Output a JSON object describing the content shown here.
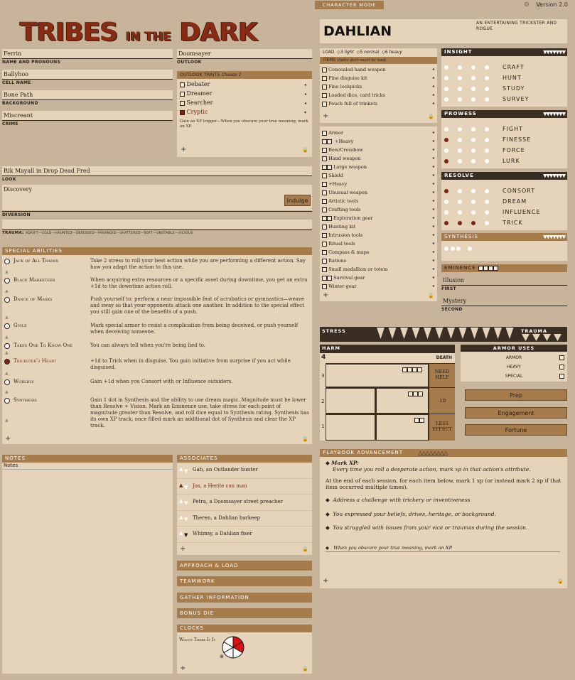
{
  "topbar": {
    "mode": "CHARACTER MODE",
    "version": "Version 2.0"
  },
  "logo": {
    "part1": "TRIBES",
    "part2": "IN THE",
    "part3": "DARK"
  },
  "identity": {
    "name_value": "Ferrin",
    "name_label": "NAME AND PRONOUNS",
    "cell_value": "Ballyhoo",
    "cell_label": "CELL NAME",
    "background_value": "Bone Path",
    "background_label": "BACKGROUND",
    "crime_value": "Miscreant",
    "crime_label": "CRIME",
    "outlook_value": "Doomsayer",
    "outlook_label": "OUTLOOK",
    "look_value": "Rik Mayall in Drop Dead Fred",
    "look_label": "LOOK",
    "diversion_value": "Discovery",
    "diversion_label": "DIVERSION",
    "indulge": "Indulge",
    "trauma_label": "TRAUMA:",
    "trauma_list": "ADRIFT—COLD—HAUNTED—OBSESSED—PARANOID—SHATTERED—SOFT—UNSTABLE—VICIOUS"
  },
  "outlook_traits": {
    "title": "OUTLOOK TRAITS",
    "choose": "Choose 2",
    "items": [
      {
        "label": "Debater",
        "checked": false
      },
      {
        "label": "Dreamer",
        "checked": false
      },
      {
        "label": "Searcher",
        "checked": false
      },
      {
        "label": "Cryptic",
        "checked": true
      }
    ],
    "note": "Gain an XP trigger—When you obscure your true meaning, mark an XP."
  },
  "character": {
    "name": "DAHLIAN",
    "tagline": "AN ENTERTAINING TRICKSTER AND ROGUE"
  },
  "load": {
    "label": "LOAD",
    "light": "3",
    "light_label": "light",
    "normal": "5",
    "normal_label": "normal",
    "heavy": "6",
    "heavy_label": "heavy",
    "items_label": "ITEMS",
    "items_note": "(italics don't count for load)"
  },
  "items_special": [
    "Concealed hand weapon",
    "Fine disguise kit",
    "Fine lockpicks",
    "Loaded dice, card tricks",
    "Pouch full of trinkets"
  ],
  "items_common": [
    {
      "label": "Armor",
      "boxes": 1
    },
    {
      "label": "+Heavy",
      "boxes": 2,
      "indent": true
    },
    {
      "label": "Bow/Crossbow",
      "boxes": 1
    },
    {
      "label": "Hand weapon",
      "boxes": 1
    },
    {
      "label": "Large weapon",
      "boxes": 2
    },
    {
      "label": "Shield",
      "boxes": 1
    },
    {
      "label": "+Heavy",
      "boxes": 1
    },
    {
      "label": "Unusual weapon",
      "boxes": 1
    },
    {
      "label": "Artistic tools",
      "boxes": 1
    },
    {
      "label": "Crafting tools",
      "boxes": 1
    },
    {
      "label": "Exploration gear",
      "boxes": 2
    },
    {
      "label": "Hunting kit",
      "boxes": 1
    },
    {
      "label": "Intrusion tools",
      "boxes": 1
    },
    {
      "label": "Ritual tools",
      "boxes": 1
    },
    {
      "label": "Compass & maps",
      "boxes": 1
    },
    {
      "label": "Rations",
      "boxes": 1
    },
    {
      "label": "Small medallion or totem",
      "boxes": 1
    },
    {
      "label": "Survival gear",
      "boxes": 2
    },
    {
      "label": "Winter gear",
      "boxes": 1
    }
  ],
  "attributes": [
    {
      "name": "INSIGHT",
      "actions": [
        {
          "label": "CRAFT",
          "dots": 0
        },
        {
          "label": "HUNT",
          "dots": 0
        },
        {
          "label": "STUDY",
          "dots": 0
        },
        {
          "label": "SURVEY",
          "dots": 0
        }
      ]
    },
    {
      "name": "PROWESS",
      "actions": [
        {
          "label": "FIGHT",
          "dots": 0
        },
        {
          "label": "FINESSE",
          "dots": 1
        },
        {
          "label": "FORCE",
          "dots": 0
        },
        {
          "label": "LURK",
          "dots": 1
        }
      ]
    },
    {
      "name": "RESOLVE",
      "actions": [
        {
          "label": "CONSORT",
          "dots": 1
        },
        {
          "label": "DREAM",
          "dots": 0
        },
        {
          "label": "INFLUENCE",
          "dots": 0
        },
        {
          "label": "TRICK",
          "dots": 3
        }
      ]
    }
  ],
  "synthesis": {
    "label": "SYNTHESIS"
  },
  "eminence": {
    "label": "EMINENCE",
    "first_value": "Illusion",
    "first_label": "FIRST",
    "second_value": "Mystery",
    "second_label": "SECOND"
  },
  "stress": {
    "label": "STRESS",
    "trauma_label": "TRAUMA"
  },
  "harm": {
    "label": "HARM",
    "death": "DEATH",
    "level4": "4",
    "level3": "3",
    "level2": "2",
    "level1": "1",
    "need_help": "NEED HELP",
    "minus_d": "-1D",
    "less_effect": "LESS EFFECT"
  },
  "armor_uses": {
    "label": "ARMOR USES",
    "items": [
      "ARMOR",
      "HEAVY",
      "SPECIAL"
    ]
  },
  "rolls": [
    "Prep",
    "Engagement",
    "Fortune"
  ],
  "special_abilities": {
    "title": "SPECIAL ABILITIES",
    "items": [
      {
        "name": "Jack of All Trades",
        "desc": "Take 2 stress to roll your best action while you are performing a different action. Say how you adapt the action to this use.",
        "taken": false
      },
      {
        "name": "Black Marketeer",
        "desc": "When acquiring extra resources or a specific asset during downtime, you get an extra +1d to the downtime action roll.",
        "taken": false
      },
      {
        "name": "Dance of Masks",
        "desc": "Push yourself to: perform a near impossible feat of acrobatics or gymnastics—weave and sway so that your opponents attack one another. In addition to the special effect you still gain one of the benefits of a push.",
        "taken": false
      },
      {
        "name": "Guile",
        "desc": "Mark special armor to resist a complication from being deceived, or push yourself when deceiving someone.",
        "taken": false
      },
      {
        "name": "Takes One To Know One",
        "desc": "You can always tell when you're being lied to.",
        "taken": false
      },
      {
        "name": "Trickster's Heart",
        "desc": "+1d to Trick when in disguise. You gain initiative from surprise if you act while disguised.",
        "taken": true
      },
      {
        "name": "Worldly",
        "desc": "Gain +1d when you Consort with or Influence outsiders.",
        "taken": false
      },
      {
        "name": "Synthesis",
        "desc": "Gain 1 dot in Synthesis and the ability to use dream magic. Magnitude must be lower than Resolve + Vision. Mark an Eminence use, take stress for each point of magnitude greater than Resolve, and roll dice equal to Synthesis rating. Synthesis has its own XP track, once filled mark an additional dot of Synthesis and clear the XP track.",
        "taken": false
      }
    ]
  },
  "notes": {
    "title": "NOTES",
    "placeholder": "Notes"
  },
  "associates": {
    "title": "ASSOCIATES",
    "items": [
      {
        "label": "Gab, an Outlander hunter",
        "state": "none"
      },
      {
        "label": "Jos, a Herite con man",
        "state": "up"
      },
      {
        "label": "Petra, a Doomsayer street preacher",
        "state": "none"
      },
      {
        "label": "Theren, a Dahlian barkeep",
        "state": "none"
      },
      {
        "label": "Whimsy, a Dahlian fixer",
        "state": "down"
      }
    ]
  },
  "sections": [
    "APPROACH & LOAD",
    "TEAMWORK",
    "GATHER INFORMATION",
    "BONUS DIE"
  ],
  "clocks": {
    "title": "CLOCKS",
    "items": [
      {
        "name": "Whoop There It Is",
        "segments": 6,
        "filled": 2
      }
    ]
  },
  "advancement": {
    "title": "PLAYBOOK ADVANCEMENT",
    "mark_xp": "Mark XP:",
    "mark_xp_desc": "Every time you roll a desperate action, mark xp in that action's attribute.",
    "session": "At the end of each session, for each item below, mark 1 xp (or instead mark 2 xp if that item occurred multiple times).",
    "bullets": [
      "Address a challenge with trickery or inventiveness",
      "You expressed your beliefs, drives, heritage, or background.",
      "You struggled with issues from your vice or traumas during the session."
    ],
    "custom": "When you obscure your true meaning, mark an XP."
  },
  "colors": {
    "accent": "#a67c4c",
    "panel": "#e6d4ba",
    "background": "#c7b49b",
    "mark": "#7a2416",
    "clock_fill": "#e01010"
  }
}
